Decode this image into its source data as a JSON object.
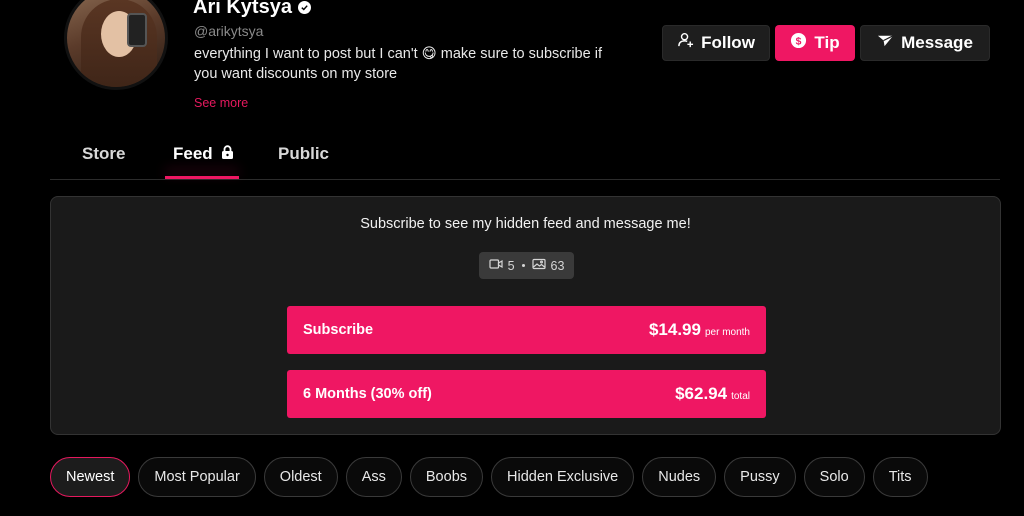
{
  "profile": {
    "name": "Ari Kytsya",
    "handle": "@arikytsya",
    "bio": "everything I want to post but I can't 😋 make sure to subscribe if you want discounts on my store",
    "see_more": "See more"
  },
  "actions": {
    "follow": "Follow",
    "tip": "Tip",
    "message": "Message"
  },
  "tabs": [
    {
      "label": "Store"
    },
    {
      "label": "Feed",
      "locked": true,
      "active": true
    },
    {
      "label": "Public"
    }
  ],
  "panel": {
    "title": "Subscribe to see my hidden feed and message me!",
    "video_count": "5",
    "photo_count": "63",
    "plans": [
      {
        "label": "Subscribe",
        "price": "$14.99",
        "note": "per month"
      },
      {
        "label": "6 Months (30% off)",
        "price": "$62.94",
        "note": "total"
      }
    ]
  },
  "filters": [
    {
      "label": "Newest",
      "active": true
    },
    {
      "label": "Most Popular"
    },
    {
      "label": "Oldest"
    },
    {
      "label": "Ass"
    },
    {
      "label": "Boobs"
    },
    {
      "label": "Hidden Exclusive"
    },
    {
      "label": "Nudes"
    },
    {
      "label": "Pussy"
    },
    {
      "label": "Solo"
    },
    {
      "label": "Tits"
    }
  ],
  "colors": {
    "accent": "#ef1763",
    "background": "#000000",
    "panel": "#1a1a1a"
  }
}
